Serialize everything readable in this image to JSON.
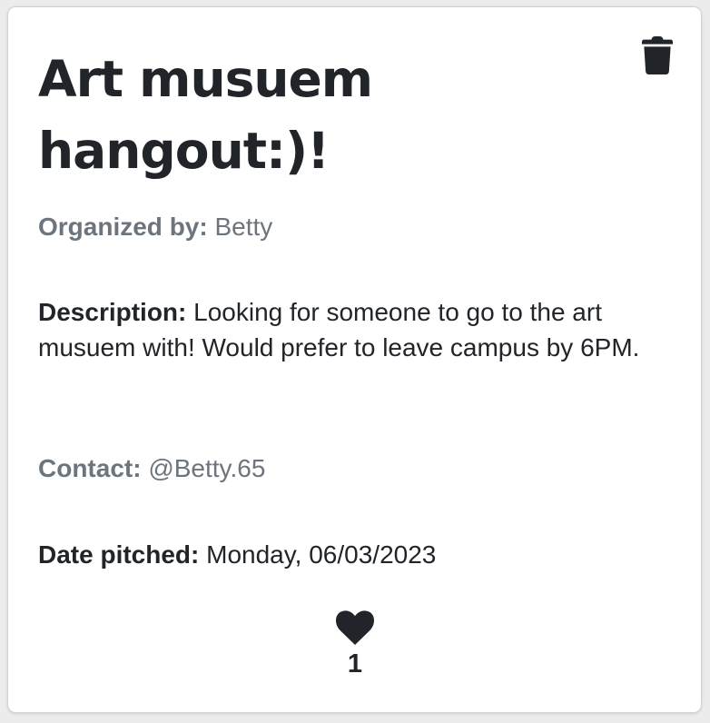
{
  "card": {
    "title": "Art musuem hangout:)!",
    "organizer": {
      "label": "Organized by:",
      "value": "Betty"
    },
    "description": {
      "label": "Description:",
      "value": "Looking for someone to go to the art musuem with! Would prefer to leave campus by 6PM."
    },
    "contact": {
      "label": "Contact:",
      "value": "@Betty.65"
    },
    "date": {
      "label": "Date pitched:",
      "value": "Monday, 06/03/2023"
    },
    "likes": {
      "count": "1"
    },
    "icons": {
      "delete": "trash-icon",
      "like": "heart-icon"
    }
  },
  "colors": {
    "heading": "#212529",
    "muted": "#6c757d",
    "card_background": "#ffffff",
    "card_border": "#d2d2d2"
  }
}
